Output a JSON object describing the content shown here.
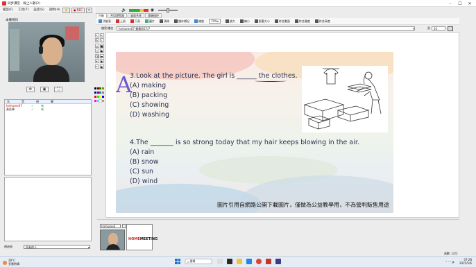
{
  "window": {
    "title": "同步課堂 - 線上人數(2)"
  },
  "menu": [
    "檔案(F)",
    "工具(T)",
    "設定(S)",
    "說明(H)"
  ],
  "top_controls": {
    "rec_label": "● REC"
  },
  "left": {
    "camera_label": "本機視訊",
    "users_header": [
      "名",
      "音",
      "視",
      "筆"
    ],
    "users": [
      {
        "name": "hmhome07",
        "check": "✓",
        "mark": "有"
      },
      {
        "name": "黃佳暐",
        "check": "✓",
        "mark": "有"
      }
    ],
    "send_label": "傳送給",
    "send_to": "所有的人"
  },
  "tabs": [
    "白板",
    "共用瀏覽器",
    "桌面共享",
    "遠端操控"
  ],
  "toolbar": [
    "功能表",
    "上頁",
    "下頁",
    "圖片",
    "清除",
    "儲存標記",
    "縮放",
    "70%",
    "放大",
    "縮小",
    "跟著大小",
    "符合畫面",
    "符合寬度",
    "符合高度"
  ],
  "file": {
    "label": "檔案/檔名",
    "name": "hmhome07 書畫頁27/7",
    "page_label": "頁",
    "page": "10"
  },
  "slide": {
    "q3": "3.Look at the picture. The girl is ______  the clothes.",
    "q3_options": [
      "(A) making",
      "(B) packing",
      "(C) showing",
      "(D) washing"
    ],
    "q4": "4.The _______ is so strong today that my hair keeps blowing in the air.",
    "q4_options": [
      "(A) rain",
      "(B) snow",
      "(C) sun",
      "(D) wind"
    ],
    "handwritten": "A",
    "caption": "圖片引用自網路公開下載圖片，僅做為公益教學用，不為營利販售用途"
  },
  "thumbs": {
    "label": "hmhome0",
    "logo_a": "HOME",
    "logo_b": "MEETING"
  },
  "status_text": "頁數: 1/22",
  "taskbar": {
    "weather_temp": "28°C",
    "weather_desc": "多雲時晴",
    "search": "搜尋",
    "time": "07:28",
    "date": "2025/5/6"
  }
}
